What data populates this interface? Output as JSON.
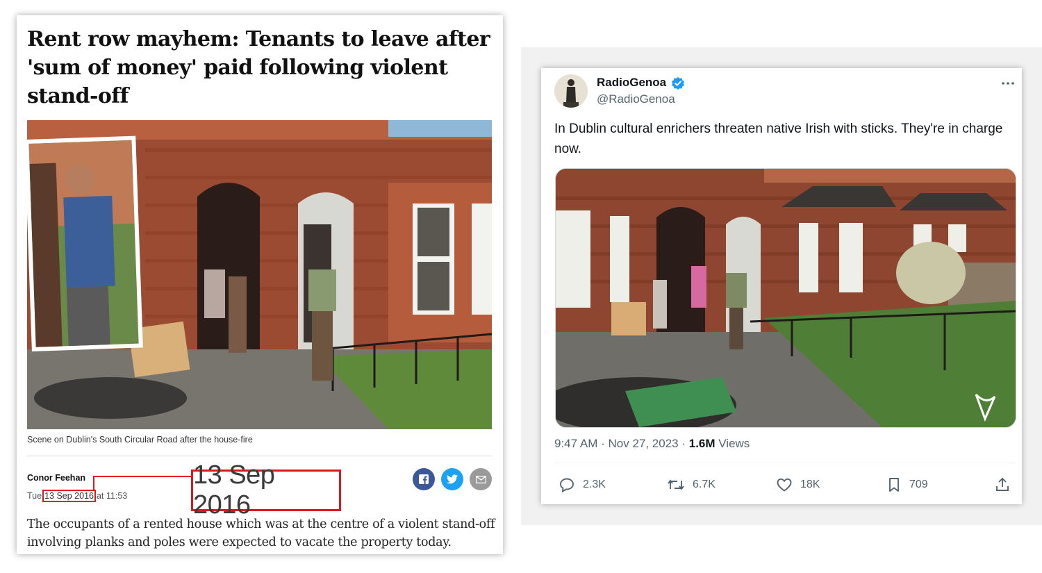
{
  "article": {
    "headline": "Rent row mayhem: Tenants to leave after 'sum of money' paid following violent stand-off",
    "caption": "Scene on Dublin's South Circular Road after the house-fire",
    "author": "Conor Feehan",
    "date_prefix": "Tue",
    "date": "13 Sep 2016",
    "date_suffix": "at 11:53",
    "highlight_date": "13 Sep 2016",
    "lede": "The occupants of a rented house which was at the centre of a violent stand-off involving planks and poles were expected to vacate the property today.",
    "share_icons": [
      "facebook-icon",
      "twitter-icon",
      "email-icon"
    ],
    "highlight_color": "#e0161e"
  },
  "tweet": {
    "display_name": "RadioGenoa",
    "handle": "@RadioGenoa",
    "verified": true,
    "text": "In Dublin cultural enrichers threaten native Irish with sticks. They're in charge now.",
    "time": "9:47 AM",
    "date": "Nov 27, 2023",
    "views_count": "1.6M",
    "views_label": "Views",
    "actions": {
      "replies": "2.3K",
      "reposts": "6.7K",
      "likes": "18K",
      "bookmarks": "709"
    },
    "accent_color": "#1d9bf0"
  }
}
